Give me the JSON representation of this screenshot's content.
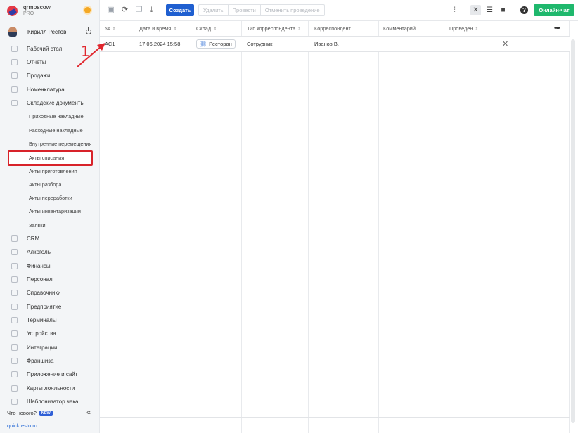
{
  "brand": {
    "name": "qrmoscow",
    "plan": "PRO"
  },
  "user": {
    "name": "Кирилл Рестов"
  },
  "nav": {
    "items": [
      {
        "label": "Рабочий стол",
        "icon": "dashboard-icon"
      },
      {
        "label": "Отчеты",
        "icon": "reports-icon"
      },
      {
        "label": "Продажи",
        "icon": "cart-icon"
      },
      {
        "label": "Номенклатура",
        "icon": "tag-icon"
      },
      {
        "label": "Складские документы",
        "icon": "box-icon"
      }
    ],
    "sub_items": [
      "Приходные накладные",
      "Расходные накладные",
      "Внутренние перемещения",
      "Акты списания",
      "Акты приготовления",
      "Акты разбора",
      "Акты переработки",
      "Акты инвентаризации",
      "Заявки"
    ],
    "more_items": [
      {
        "label": "CRM",
        "icon": "crm-icon"
      },
      {
        "label": "Алкоголь",
        "icon": "glass-icon"
      },
      {
        "label": "Финансы",
        "icon": "wallet-icon"
      },
      {
        "label": "Персонал",
        "icon": "user-icon"
      },
      {
        "label": "Справочники",
        "icon": "book-icon"
      },
      {
        "label": "Предприятие",
        "icon": "building-icon"
      },
      {
        "label": "Терминалы",
        "icon": "terminal-icon"
      },
      {
        "label": "Устройства",
        "icon": "device-icon"
      },
      {
        "label": "Интеграции",
        "icon": "integration-icon"
      },
      {
        "label": "Франшиза",
        "icon": "franchise-icon"
      },
      {
        "label": "Приложение и сайт",
        "icon": "app-icon"
      },
      {
        "label": "Карты лояльности",
        "icon": "card-icon"
      },
      {
        "label": "Шаблонизатор чека",
        "icon": "receipt-icon"
      }
    ],
    "whats_new": "Что нового?",
    "new_badge": "NEW",
    "site_link": "quickresto.ru"
  },
  "toolbar": {
    "create": "Создать",
    "delete": "Удалить",
    "post": "Провести",
    "unpost": "Отменить проведение",
    "chat": "Онлайн-чат"
  },
  "table": {
    "columns": [
      "№",
      "Дата и время",
      "Склад",
      "Тип корреспондента",
      "Корреспондент",
      "Комментарий",
      "Проведен"
    ],
    "rows": [
      {
        "number": "АС1",
        "datetime": "17.06.2024 15:58",
        "store": "Ресторан",
        "corr_type": "Сотрудник",
        "correspondent": "Иванов В.",
        "comment": "",
        "posted": ""
      }
    ]
  },
  "annotation": {
    "step": "1"
  },
  "colors": {
    "accent": "#1f5fd0",
    "chat": "#1fb86d",
    "highlight": "#d8232a"
  }
}
